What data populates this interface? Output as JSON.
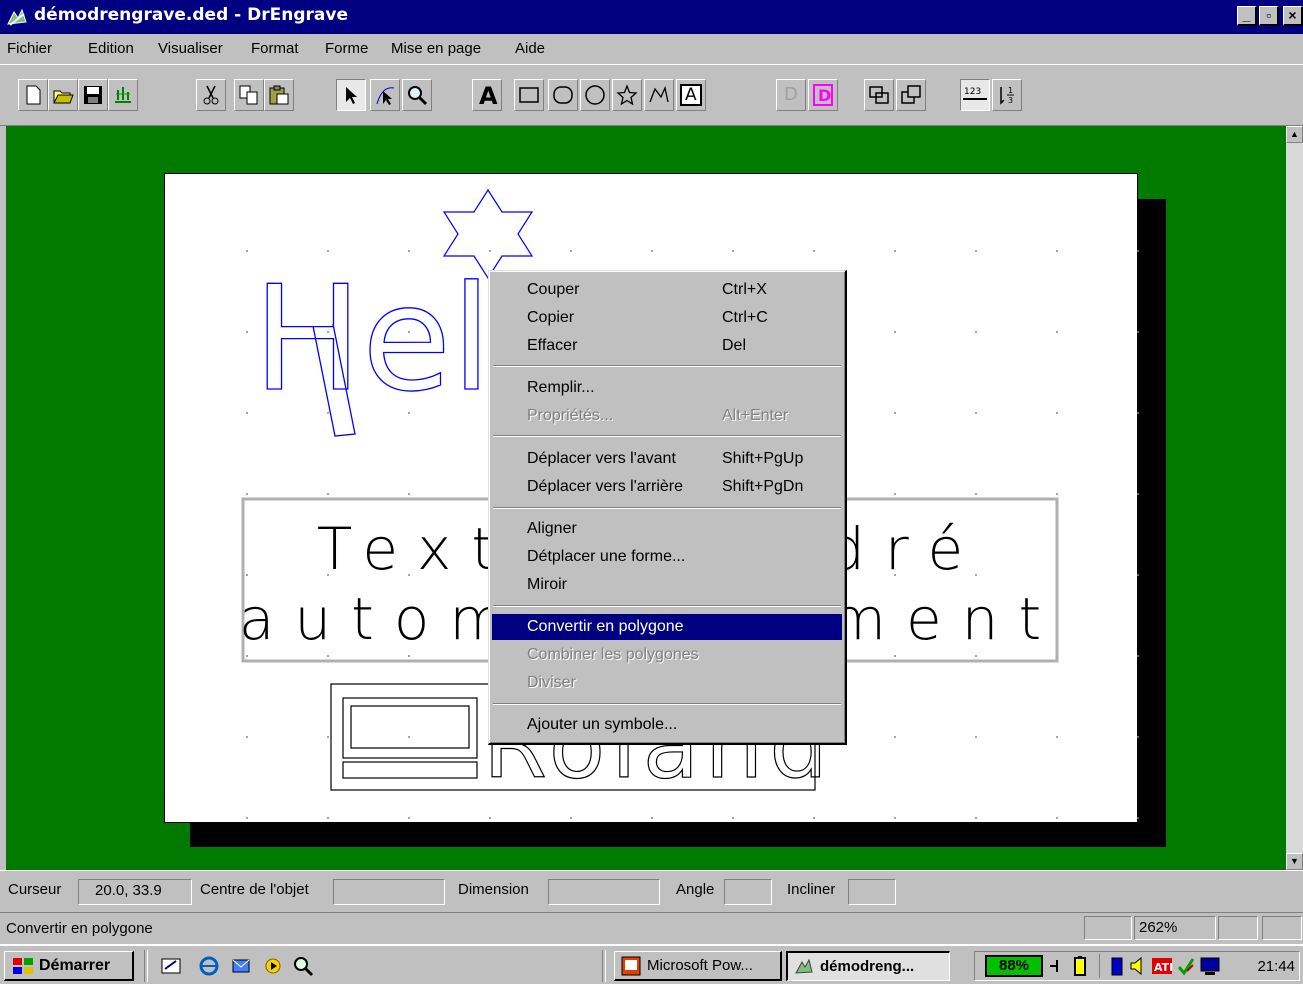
{
  "window": {
    "title": "démodrengrave.ded - DrEngrave",
    "min_glyph": "_",
    "max_glyph": "▫",
    "close_glyph": "×"
  },
  "menu": [
    {
      "label": "Fichier"
    },
    {
      "label": "Edition"
    },
    {
      "label": "Visualiser"
    },
    {
      "label": "Format"
    },
    {
      "label": "Forme"
    },
    {
      "label": "Mise en page"
    },
    {
      "label": "Aide"
    }
  ],
  "toolbar": {
    "icons": [
      "new-icon",
      "open-icon",
      "save-icon",
      "engrave-icon",
      "cut-icon",
      "copy-icon",
      "paste-icon",
      "select-arrow-icon",
      "node-edit-icon",
      "zoom-icon",
      "text-icon",
      "rectangle-icon",
      "rounded-rect-icon",
      "ellipse-icon",
      "star-icon",
      "polyline-icon",
      "framed-text-icon",
      "dimmed-d-icon",
      "magenta-d-icon",
      "group-icon",
      "ungroup-icon",
      "numbering-icon",
      "fraction-icon"
    ],
    "text_glyph": "A",
    "framed_text_glyph": "A",
    "d_glyph": "D",
    "num_glyph": "123"
  },
  "canvas": {
    "hello_text": "Hell",
    "frame_text_line1": "Texte encadré",
    "frame_text_line2": "automatiquement",
    "logo_text": "Roland",
    "colors": {
      "background": "#007a00",
      "page": "#ffffff",
      "shadow": "#000000",
      "outline_blue": "#0000ff"
    }
  },
  "context_menu": {
    "items": [
      {
        "label": "Couper",
        "shortcut": "Ctrl+X"
      },
      {
        "label": "Copier",
        "shortcut": "Ctrl+C"
      },
      {
        "label": "Effacer",
        "shortcut": "Del"
      },
      {
        "label": "Remplir...",
        "shortcut": ""
      },
      {
        "label": "Propriétés...",
        "shortcut": "Alt+Enter"
      },
      {
        "label": "Déplacer vers l'avant",
        "shortcut": "Shift+PgUp"
      },
      {
        "label": "Déplacer vers l'arrière",
        "shortcut": "Shift+PgDn"
      },
      {
        "label": "Aligner",
        "shortcut": ""
      },
      {
        "label": "Détplacer une forme...",
        "shortcut": ""
      },
      {
        "label": "Miroir",
        "shortcut": ""
      },
      {
        "label": "Convertir en polygone",
        "shortcut": ""
      },
      {
        "label": "Combiner les polygones",
        "shortcut": ""
      },
      {
        "label": "Diviser",
        "shortcut": ""
      },
      {
        "label": "Ajouter un symbole...",
        "shortcut": ""
      }
    ],
    "highlight_color": "#000080"
  },
  "statusbar": {
    "cursor_label": "Curseur",
    "cursor_value": "20.0, 33.9",
    "center_label": "Centre de l'objet",
    "center_value": "",
    "dimension_label": "Dimension",
    "dimension_value": "",
    "angle_label": "Angle",
    "angle_value": "",
    "incline_label": "Incliner",
    "incline_value": "",
    "message": "Convertir en polygone",
    "zoom": "262%"
  },
  "taskbar": {
    "start_label": "Démarrer",
    "tasks": [
      {
        "label": "Microsoft Pow..."
      },
      {
        "label": "démodreng..."
      }
    ],
    "battery": "88%",
    "clock": "21:44"
  }
}
